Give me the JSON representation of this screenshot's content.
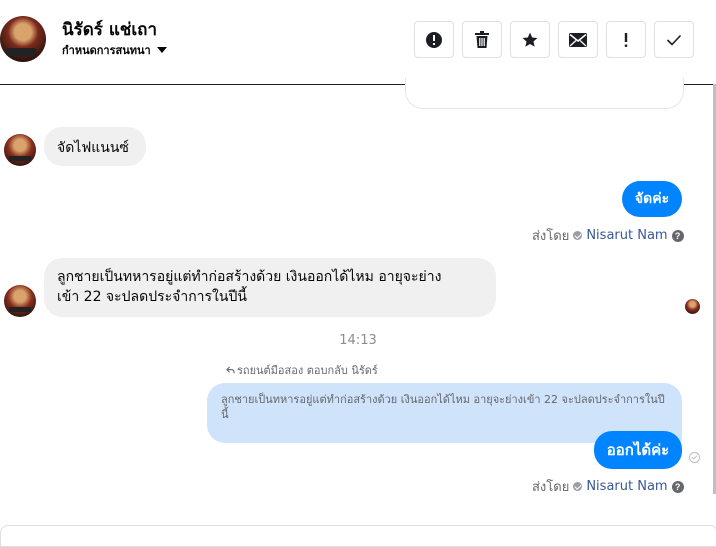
{
  "header": {
    "contact_name": "นิรัดร์ แช่เถา",
    "subtitle": "กำหนดการสนทนา",
    "toolbar": [
      {
        "name": "alert-button",
        "icon": "exclamation-circle-icon"
      },
      {
        "name": "delete-button",
        "icon": "trash-icon"
      },
      {
        "name": "star-button",
        "icon": "star-icon"
      },
      {
        "name": "mail-button",
        "icon": "envelope-icon"
      },
      {
        "name": "mark-button",
        "icon": "exclamation-icon"
      },
      {
        "name": "done-button",
        "icon": "check-icon"
      }
    ]
  },
  "messages": {
    "m1_text": "จัดไฟแนนซ์",
    "m2_text": "จัดค่ะ",
    "m3_text_line1": "ลูกชายเป็นทหารอยู่แต่ทำก่อสร้างด้วย เงินออกได้ไหม อายุจะย่าง",
    "m3_text_line2": "เข้า 22 จะปลดประจำการในปีนี้",
    "time_divider": "14:13",
    "reply_header": "รถยนต์มือสอง ตอบกลับ นิรัดร์",
    "quoted_text": "ลูกชายเป็นทหารอยู่แต่ทำก่อสร้างด้วย เงินออกได้ไหม อายุจะย่างเข้า 22 จะปลดประจำการในปีนี้",
    "m4_text": "ออกได้ค่ะ"
  },
  "sent_by": {
    "label": "ส่งโดย",
    "sender": "Nisarut Nam",
    "help": "?"
  },
  "colors": {
    "outgoing_bubble": "#0084ff",
    "incoming_bubble": "#f0f0f0",
    "quoted_bubble": "#cfe3fb",
    "sender_link": "#385898"
  }
}
